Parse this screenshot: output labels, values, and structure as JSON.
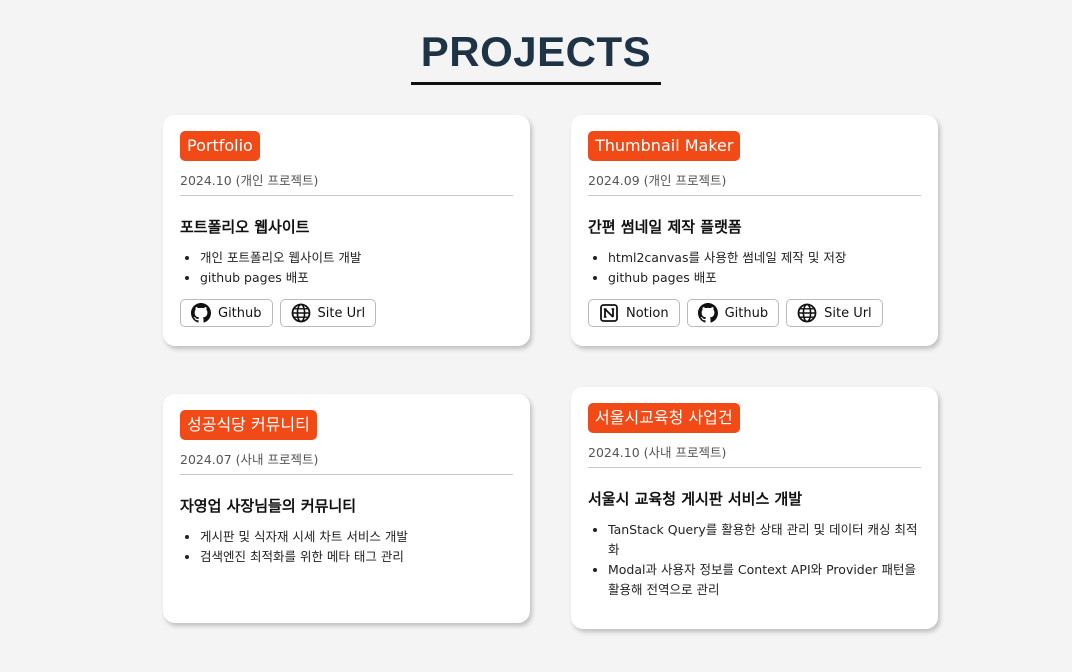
{
  "page": {
    "title": "PROJECTS"
  },
  "projects": [
    {
      "name": "Portfolio",
      "date": "2024.10 (개인 프로젝트)",
      "description": "포트폴리오 웹사이트",
      "items": [
        "개인 포트폴리오 웹사이트 개발",
        "github pages 배포"
      ],
      "links": [
        {
          "label": "Github",
          "icon": "github-icon"
        },
        {
          "label": "Site Url",
          "icon": "globe-icon"
        }
      ]
    },
    {
      "name": "Thumbnail Maker",
      "date": "2024.09 (개인 프로젝트)",
      "description": "간편 썸네일 제작 플랫폼",
      "items": [
        "html2canvas를 사용한 썸네일 제작 및 저장",
        "github pages 배포"
      ],
      "links": [
        {
          "label": "Notion",
          "icon": "notion-icon"
        },
        {
          "label": "Github",
          "icon": "github-icon"
        },
        {
          "label": "Site Url",
          "icon": "globe-icon"
        }
      ]
    },
    {
      "name": "성공식당 커뮤니티",
      "date": "2024.07 (사내 프로젝트)",
      "description": "자영업 사장님들의 커뮤니티",
      "items": [
        "게시판 및 식자재 시세 차트 서비스 개발",
        "검색엔진 최적화를 위한 메타 태그 관리"
      ],
      "links": []
    },
    {
      "name": "서울시교육청 사업건",
      "date": "2024.10 (사내 프로젝트)",
      "description": "서울시 교육청 게시판 서비스 개발",
      "items": [
        "TanStack Query를 활용한 상태 관리 및 데이터 캐싱 최적화",
        "Modal과 사용자 정보를 Context API와 Provider 패턴을 활용해 전역으로 관리"
      ],
      "links": []
    }
  ],
  "colors": {
    "badge": "#f14a16",
    "title": "#1f3347",
    "background": "#f4f4f4"
  }
}
